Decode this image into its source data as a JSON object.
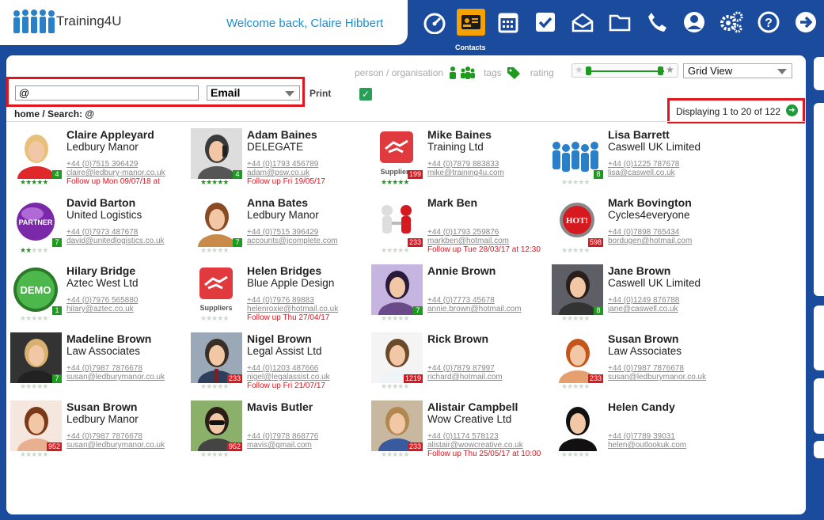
{
  "app": {
    "name": "Training4U",
    "welcome": "Welcome back, Claire Hibbert"
  },
  "nav": {
    "active_label": "Contacts",
    "items": [
      "dashboard-icon",
      "contacts-icon",
      "calendar-icon",
      "tasks-icon",
      "mail-icon",
      "folder-icon",
      "phone-icon",
      "user-icon",
      "settings-icon",
      "help-icon",
      "logout-icon"
    ]
  },
  "filters": {
    "person_org": "person / organisation",
    "tags": "tags",
    "rating": "rating",
    "view": "Grid View",
    "print": "Print"
  },
  "search": {
    "value": "@",
    "type": "Email",
    "breadcrumb": "home / Search: @"
  },
  "paging": {
    "display": "Displaying 1 to 20 of 122"
  },
  "contacts": [
    {
      "name": "Claire Appleyard",
      "org": "Ledbury Manor",
      "phone": "+44 (0)7515 396429",
      "email": "claire@ledbury-manor.co.uk",
      "follow": "Follow up Mon 09/07/18 at",
      "badge": "4",
      "badge_color": "g",
      "stars": 5,
      "avatar": "woman-red"
    },
    {
      "name": "Adam Baines",
      "org": "DELEGATE",
      "phone": "+44 (0)1793 456789",
      "email": "adam@psw.co.uk",
      "follow": "Follow up Fri 19/05/17",
      "badge": "4",
      "badge_color": "g",
      "stars": 5,
      "avatar": "man-phone"
    },
    {
      "name": "Mike Baines",
      "org": "Training Ltd",
      "phone": "+44 (0)7879 883833",
      "email": "mike@training4u.com",
      "follow": "",
      "badge": "199",
      "badge_color": "r",
      "stars": 5,
      "avatar": "suppliers",
      "avatar_text": "Suppliers"
    },
    {
      "name": "Lisa Barrett",
      "org": "Caswell UK Limited",
      "phone": "+44 (0)1225 787678",
      "email": "lisa@caswell.co.uk",
      "follow": "",
      "badge": "8",
      "badge_color": "g",
      "stars": 0,
      "avatar": "people"
    },
    {
      "name": "David Barton",
      "org": "United Logistics",
      "phone": "+44 (0)7973 487678",
      "email": "david@unitedlogistics.co.uk",
      "follow": "",
      "badge": "7",
      "badge_color": "g",
      "stars": 2,
      "avatar": "partner",
      "avatar_text": "PARTNER"
    },
    {
      "name": "Anna Bates",
      "org": "Ledbury Manor",
      "phone": "+44 (0)7515 396429",
      "email": "accounts@jcomplete.com",
      "follow": "",
      "badge": "7",
      "badge_color": "g",
      "stars": 0,
      "avatar": "woman-brown"
    },
    {
      "name": "Mark Ben",
      "org": "",
      "phone": "+44 (0)1793 259876",
      "email": "markben@hotmail.com",
      "follow": "Follow up Tue 28/03/17 at 12:30",
      "badge": "233",
      "badge_color": "r",
      "stars": 0,
      "avatar": "handshake3d"
    },
    {
      "name": "Mark Bovington",
      "org": "Cycles4everyone",
      "phone": "+44 (0)7898 765434",
      "email": "bordugen@hotmail.com",
      "follow": "",
      "badge": "598",
      "badge_color": "r",
      "stars": 0,
      "avatar": "hot",
      "avatar_text": "HOT!"
    },
    {
      "name": "Hilary Bridge",
      "org": "Aztec West Ltd",
      "phone": "+44 (0)7976 565880",
      "email": "hilary@aztec.co.uk",
      "follow": "",
      "badge": "1",
      "badge_color": "g",
      "stars": 0,
      "avatar": "demo",
      "avatar_text": "DEMO"
    },
    {
      "name": "Helen Bridges",
      "org": "Blue Apple Design",
      "phone": "+44 (0)7976 89883",
      "email": "helenroxie@hotmail.co.uk",
      "follow": "Follow up Thu 27/04/17",
      "badge": "",
      "badge_color": "g",
      "stars": 0,
      "avatar": "suppliers",
      "avatar_text": "Suppliers"
    },
    {
      "name": "Annie Brown",
      "org": "",
      "phone": "+44 (0)7773 45678",
      "email": "annie.brown@hotmail.com",
      "follow": "",
      "badge": "7",
      "badge_color": "g",
      "stars": 0,
      "avatar": "woman-dark"
    },
    {
      "name": "Jane Brown",
      "org": "Caswell UK Limited",
      "phone": "+44 (0)1249 876788",
      "email": "jane@caswell.co.uk",
      "follow": "",
      "badge": "8",
      "badge_color": "g",
      "stars": 0,
      "avatar": "woman-stand"
    },
    {
      "name": "Madeline Brown",
      "org": "Law Associates",
      "phone": "+44 (0)7987 7876678",
      "email": "susan@ledburymanor.co.uk",
      "follow": "",
      "badge": "7",
      "badge_color": "g",
      "stars": 0,
      "avatar": "woman-blonde"
    },
    {
      "name": "Nigel Brown",
      "org": "Legal Assist Ltd",
      "phone": "+44 (0)1203 487666",
      "email": "nigel@legalassist.co.uk",
      "follow": "Follow up Fri 21/07/17",
      "badge": "233",
      "badge_color": "r",
      "stars": 0,
      "avatar": "man-suit"
    },
    {
      "name": "Rick Brown",
      "org": "",
      "phone": "+44 (0)7879 87997",
      "email": "richard@hotmail.com",
      "follow": "",
      "badge": "1219",
      "badge_color": "r",
      "stars": 0,
      "avatar": "man-shirt"
    },
    {
      "name": "Susan Brown",
      "org": "Law Associates",
      "phone": "+44 (0)7987 7876678",
      "email": "susan@ledburymanor.co.uk",
      "follow": "",
      "badge": "233",
      "badge_color": "r",
      "stars": 0,
      "avatar": "woman-red-hair"
    },
    {
      "name": "Susan Brown",
      "org": "Ledbury Manor",
      "phone": "+44 (0)7987 7876678",
      "email": "susan@ledburymanor.co.uk",
      "follow": "",
      "badge": "952",
      "badge_color": "r",
      "stars": 0,
      "avatar": "woman-face"
    },
    {
      "name": "Mavis Butler",
      "org": "",
      "phone": "+44 (0)7978 868776",
      "email": "mavis@gmail.com",
      "follow": "",
      "badge": "952",
      "badge_color": "r",
      "stars": 0,
      "avatar": "woman-sunglasses"
    },
    {
      "name": "Alistair Campbell",
      "org": "Wow Creative Ltd",
      "phone": "+44 (0)1174 578123",
      "email": "alistair@wowcreative.co.uk",
      "follow": "Follow up Thu 25/05/17 at 10:00",
      "badge": "233",
      "badge_color": "r",
      "stars": 0,
      "avatar": "man-face"
    },
    {
      "name": "Helen Candy",
      "org": "",
      "phone": "+44 (0)7789 39031",
      "email": "helen@outlookuk.com",
      "follow": "",
      "badge": "",
      "badge_color": "g",
      "stars": 0,
      "avatar": "woman-black"
    }
  ]
}
